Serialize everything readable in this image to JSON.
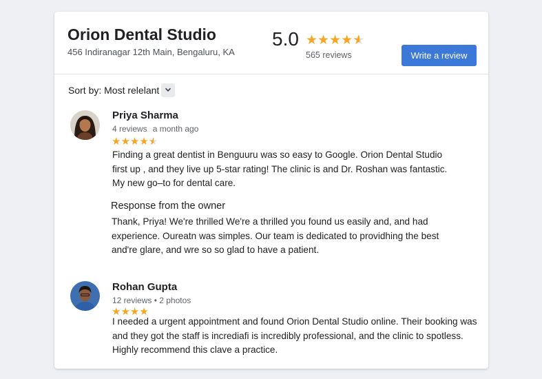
{
  "business": {
    "name": "Orion Dental Studio",
    "address": "456 Indiranagar 12th Main, Bengaluru, KA",
    "rating": "5.0",
    "rating_stars": 4.5,
    "review_count": "565 reviews",
    "write_review_label": "Write a review"
  },
  "sort": {
    "label": "Sort by: Most relelant",
    "chevron_icon": "chevron-down-icon"
  },
  "colors": {
    "star": "#f5a623",
    "button": "#3c78d8"
  },
  "reviews": [
    {
      "name": "Priya Sharma",
      "meta_count": "4 reviews",
      "meta_time": "a month ago",
      "stars": 4.5,
      "text": [
        "Finding a great dentist in Benguuru was so easy to Google. Orion Dental Studio",
        "first up , and they live up 5-star rating! The clinic is and Dr. Roshan was fantastic.",
        "My new go–to for dental care."
      ],
      "owner_response": {
        "title": "Response from the owner",
        "text": [
          "Thank, Priya! We're thrilled We're a thrilled you found us easily and, and had",
          "experience. Oureatn was simples. Our team is dedicated to providhing the best",
          "and're glare, and wre so so glad to have a patient."
        ]
      }
    },
    {
      "name": "Rohan Gupta",
      "meta_count": "12 reviews • 2 photos",
      "meta_time": "",
      "stars": 4,
      "text": [
        "I needed a urgent appointment and found Orion Dental Studio online. Their booking was",
        "and they got the staff is incrediafi is incredibly professional, and the clinic to spotless.",
        "Highly recommend this clave a practice."
      ]
    }
  ]
}
